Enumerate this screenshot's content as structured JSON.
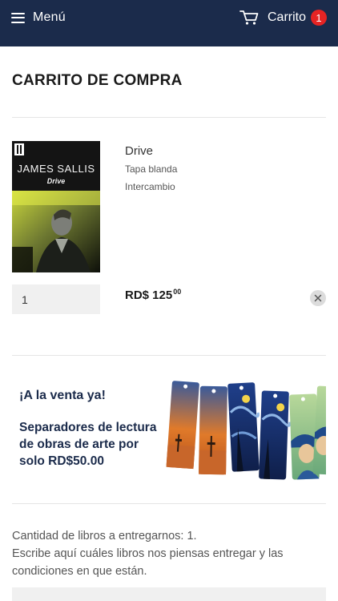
{
  "header": {
    "menu_label": "Menú",
    "cart_label": "Carrito",
    "cart_count": "1",
    "background": "#1b2b4b",
    "badge_color": "#e62424"
  },
  "page": {
    "title": "CARRITO DE COMPRA"
  },
  "cart_item": {
    "cover_author": "JAMES SALLIS",
    "cover_title": "Drive",
    "title": "Drive",
    "format": "Tapa blanda",
    "type": "Intercambio",
    "quantity": "1",
    "price_main": "RD$ 125",
    "price_cents": "00",
    "remove_icon": "close-icon"
  },
  "promo_banner": {
    "heading": "¡A la venta ya!",
    "lines": [
      "Separadores de lectura",
      "de obras de arte por",
      "solo RD$50.00"
    ]
  },
  "notes": {
    "lines": [
      "Cantidad de libros a entregarnos: 1.",
      "Escribe aquí cuáles libros nos piensas entregar y las",
      "condiciones en que están."
    ]
  }
}
